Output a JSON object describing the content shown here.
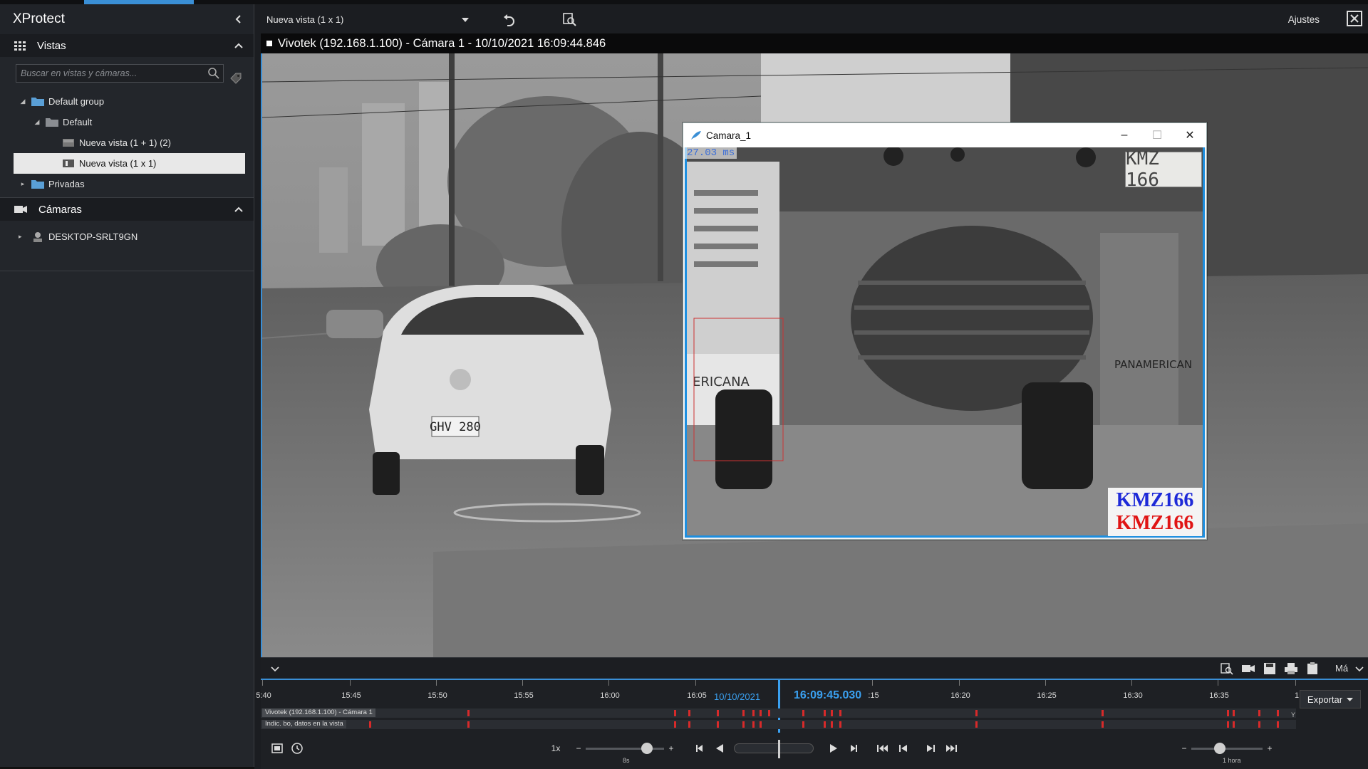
{
  "app": {
    "title": "XProtect",
    "collapse_icon": "chevron-left-icon"
  },
  "sidebar": {
    "views_section": {
      "title": "Vistas",
      "icon": "grid-icon",
      "toggle_icon": "chevron-up-icon"
    },
    "search": {
      "placeholder": "Buscar en vistas y cámaras...",
      "value": ""
    },
    "tree": [
      {
        "label": "Default group",
        "level": 0,
        "expanded": true
      },
      {
        "label": "Default",
        "level": 1,
        "expanded": true
      },
      {
        "label": "Nueva vista (1 + 1) (2)",
        "level": 2
      },
      {
        "label": "Nueva vista (1 x 1)",
        "level": 2,
        "selected": true
      },
      {
        "label": "Privadas",
        "level": 0,
        "expanded": false
      }
    ],
    "cameras_section": {
      "title": "Cámaras",
      "icon": "camera-icon",
      "toggle_icon": "chevron-up-icon"
    },
    "camera_tree": [
      {
        "label": "DESKTOP-SRLT9GN"
      }
    ]
  },
  "header": {
    "view_select": "Nueva vista (1 x 1)",
    "settings_label": "Ajustes"
  },
  "camera": {
    "title": "Vivotek (192.168.1.100) - Cámara 1 - 10/10/2021 16:09:44.846",
    "car_plate": "GHV 280"
  },
  "popup": {
    "title": "Camara_1",
    "fps_text": "27.03 ms",
    "plate_crop_text": "KMZ 166",
    "ocr_primary": "KMZ166",
    "ocr_secondary": "KMZ166",
    "truck_text_left": "ERICANA",
    "truck_text_right": "PANAMERICAN"
  },
  "controls": {
    "more_label": "Má"
  },
  "timeline": {
    "ticks": [
      "5:40",
      "15:45",
      "15:50",
      "15:55",
      "16:00",
      "16:05",
      ":15",
      "16:20",
      "16:25",
      "16:30",
      "16:35",
      "1"
    ],
    "current_date": "10/10/2021",
    "current_time": "16:09:45.030",
    "tracks": [
      {
        "label": "Vivotek (192.168.1.100) - Cámara 1"
      },
      {
        "label": "Indic. bo, datos en la vista"
      }
    ],
    "export_label": "Exportar",
    "speed_label": "1x",
    "speed_sub": "8s",
    "zoom_sub": "1 hora",
    "track_end_label": "Y"
  },
  "colors": {
    "accent": "#3a8fd6",
    "event": "#d82a2a",
    "ocr_blue": "#1e2ad8",
    "ocr_red": "#e01414"
  }
}
